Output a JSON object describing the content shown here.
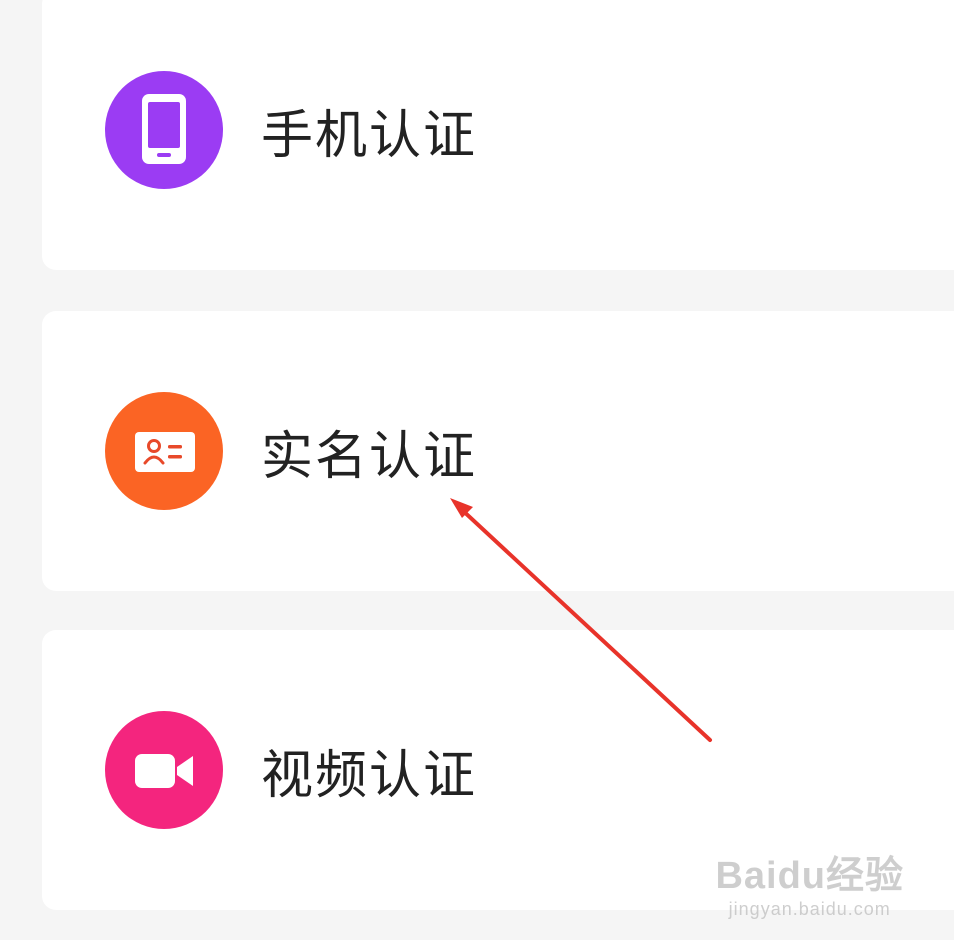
{
  "items": [
    {
      "label": "手机认证",
      "icon": "phone-icon",
      "color": "#9b3cf3"
    },
    {
      "label": "实名认证",
      "icon": "id-card-icon",
      "color": "#fb6424"
    },
    {
      "label": "视频认证",
      "icon": "video-camera-icon",
      "color": "#f4257e"
    }
  ],
  "watermark": {
    "main": "Baidu经验",
    "sub": "jingyan.baidu.com"
  },
  "colors": {
    "background": "#f5f5f5",
    "card": "#ffffff",
    "arrow": "#e8332a",
    "text": "#222222"
  }
}
